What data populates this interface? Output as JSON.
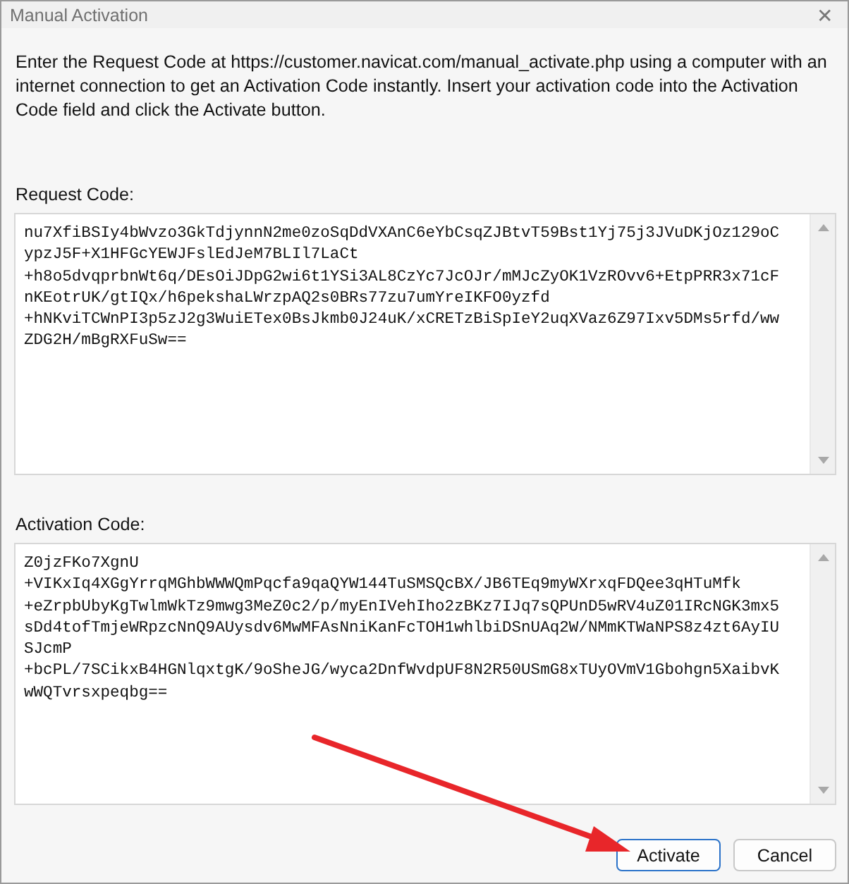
{
  "window": {
    "title": "Manual Activation",
    "close": "✕"
  },
  "instructions": "Enter the Request Code at https://customer.navicat.com/manual_activate.php using a computer with an internet connection to get an Activation Code instantly. Insert your activation code into the Activation Code field and click the Activate button.",
  "fields": [
    {
      "label": "Request Code:",
      "lines": [
        "nu7XfiBSIy4bWvzo3GkTdjynnN2me0zoSqDdVXAnC6eYbCsqZJBtvT59Bst1Yj75j3JVuDKjOz129oC",
        "ypzJ5F+X1HFGcYEWJFslEdJeM7BLIl7LaCt",
        "+h8o5dvqprbnWt6q/DEsOiJDpG2wi6t1YSi3AL8CzYc7JcOJr/mMJcZyOK1VzROvv6+EtpPRR3x71cF",
        "nKEotrUK/gtIQx/h6pekshaLWrzpAQ2s0BRs77zu7umYreIKFO0yzfd",
        "+hNKviTCWnPI3p5zJ2g3WuiETex0BsJkmb0J24uK/xCRETzBiSpIeY2uqXVaz6Z97Ixv5DMs5rfd/ww",
        "ZDG2H/mBgRXFuSw=="
      ]
    },
    {
      "label": "Activation Code:",
      "lines": [
        "Z0jzFKo7XgnU",
        "+VIKxIq4XGgYrrqMGhbWWWQmPqcfa9qaQYW144TuSMSQcBX/JB6TEq9myWXrxqFDQee3qHTuMfk",
        "+eZrpbUbyKgTwlmWkTz9mwg3MeZ0c2/p/myEnIVehIho2zBKz7IJq7sQPUnD5wRV4uZ01IRcNGK3mx5",
        "sDd4tofTmjeWRpzcNnQ9AUysdv6MwMFAsNniKanFcTOH1whlbiDSnUAq2W/NMmKTWaNPS8z4zt6AyIU",
        "SJcmP",
        "+bcPL/7SCikxB4HGNlqxtgK/9oSheJG/wyca2DnfWvdpUF8N2R50USmG8xTUyOVmV1Gbohgn5XaibvK",
        "wWQTvrsxpeqbg=="
      ]
    }
  ],
  "buttons": [
    {
      "label": "Activate",
      "focused": true
    },
    {
      "label": "Cancel",
      "focused": false
    }
  ],
  "annotation": {
    "kind": "arrow"
  }
}
